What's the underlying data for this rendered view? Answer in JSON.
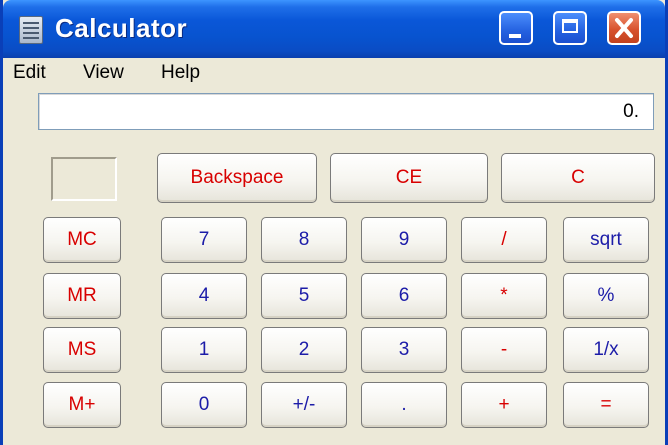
{
  "window": {
    "title": "Calculator",
    "icon": "calculator-icon",
    "controls": [
      "minimize-icon",
      "maximize-icon",
      "close-icon"
    ]
  },
  "menu": {
    "edit": "Edit",
    "view": "View",
    "help": "Help"
  },
  "display": {
    "value": "0."
  },
  "buttons": {
    "backspace": "Backspace",
    "ce": "CE",
    "c": "C",
    "mc": "MC",
    "mr": "MR",
    "ms": "MS",
    "mplus": "M+",
    "n7": "7",
    "n8": "8",
    "n9": "9",
    "n4": "4",
    "n5": "5",
    "n6": "6",
    "n1": "1",
    "n2": "2",
    "n3": "3",
    "n0": "0",
    "sign": "+/-",
    "dot": ".",
    "divide": "/",
    "multiply": "*",
    "subtract": "-",
    "add": "+",
    "sqrt": "sqrt",
    "percent": "%",
    "reciprocal": "1/x",
    "equals": "="
  },
  "colors": {
    "title_bar": "#0a57d8",
    "operator_text": "#d80000",
    "digit_text": "#1c1ca8",
    "window_bg": "#ece9d8"
  }
}
